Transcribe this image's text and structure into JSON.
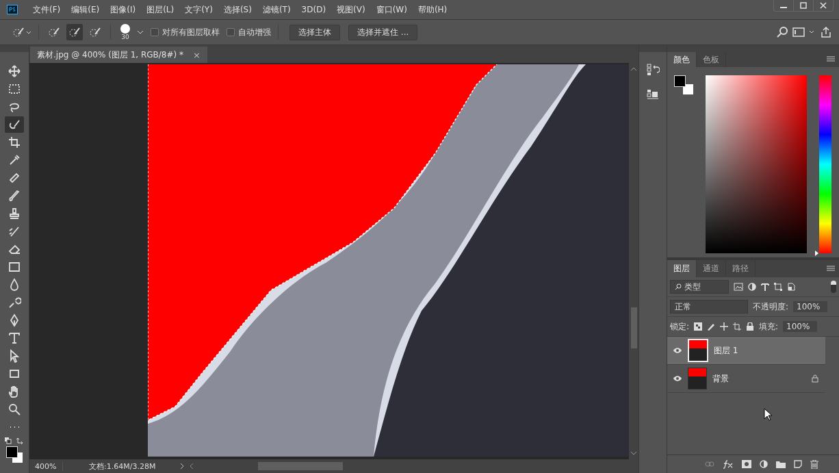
{
  "menu": [
    "文件(F)",
    "编辑(E)",
    "图像(I)",
    "图层(L)",
    "文字(Y)",
    "选择(S)",
    "滤镜(T)",
    "3D(D)",
    "视图(V)",
    "窗口(W)",
    "帮助(H)"
  ],
  "options": {
    "modes": [
      {
        "selected": false
      },
      {
        "selected": true
      },
      {
        "selected": false
      }
    ],
    "brush_size": "30",
    "checkboxes": [
      {
        "label": "对所有图层取样",
        "checked": false
      },
      {
        "label": "自动增强",
        "checked": false
      }
    ],
    "buttons": [
      "选择主体",
      "选择并遮住 ..."
    ]
  },
  "document_tab": {
    "title": "素材.jpg @ 400% (图层 1, RGB/8#) *",
    "close": "×"
  },
  "tools": [
    {
      "kind": "move",
      "selected": false
    },
    {
      "kind": "marquee",
      "selected": false
    },
    {
      "kind": "lasso",
      "selected": false
    },
    {
      "kind": "quick-select",
      "selected": true
    },
    {
      "kind": "crop",
      "selected": false
    },
    {
      "kind": "eyedropper",
      "selected": false
    },
    {
      "kind": "healing",
      "selected": false
    },
    {
      "kind": "brush",
      "selected": false
    },
    {
      "kind": "stamp",
      "selected": false
    },
    {
      "kind": "history-brush",
      "selected": false
    },
    {
      "kind": "eraser",
      "selected": false
    },
    {
      "kind": "gradient",
      "selected": false
    },
    {
      "kind": "blur",
      "selected": false
    },
    {
      "kind": "dodge",
      "selected": false
    },
    {
      "kind": "pen",
      "selected": false
    },
    {
      "kind": "type",
      "selected": false
    },
    {
      "kind": "path-select",
      "selected": false
    },
    {
      "kind": "shape",
      "selected": false
    },
    {
      "kind": "hand",
      "selected": false
    },
    {
      "kind": "zoom",
      "selected": false
    },
    {
      "kind": "more",
      "selected": false
    }
  ],
  "color_panel": {
    "tabs": [
      {
        "label": "颜色",
        "selected": true
      },
      {
        "label": "色板",
        "selected": false
      }
    ],
    "hue": {
      "level": 0
    }
  },
  "layers_panel": {
    "tabs": [
      {
        "label": "图层",
        "selected": true
      },
      {
        "label": "通道",
        "selected": false
      },
      {
        "label": "路径",
        "selected": false
      }
    ],
    "filter": "类型",
    "blend_mode": "正常",
    "opacity_label": "不透明度:",
    "opacity": "100%",
    "lock_label": "锁定:",
    "fill_label": "填充:",
    "fill": "100%",
    "layers": [
      {
        "name": "图层 1",
        "visible": true,
        "selected": true,
        "locked": false
      },
      {
        "name": "背景",
        "visible": true,
        "selected": false,
        "locked": true
      }
    ]
  },
  "status_bar": {
    "zoom": "400%",
    "doc_info": "文档:1.64M/3.28M"
  }
}
